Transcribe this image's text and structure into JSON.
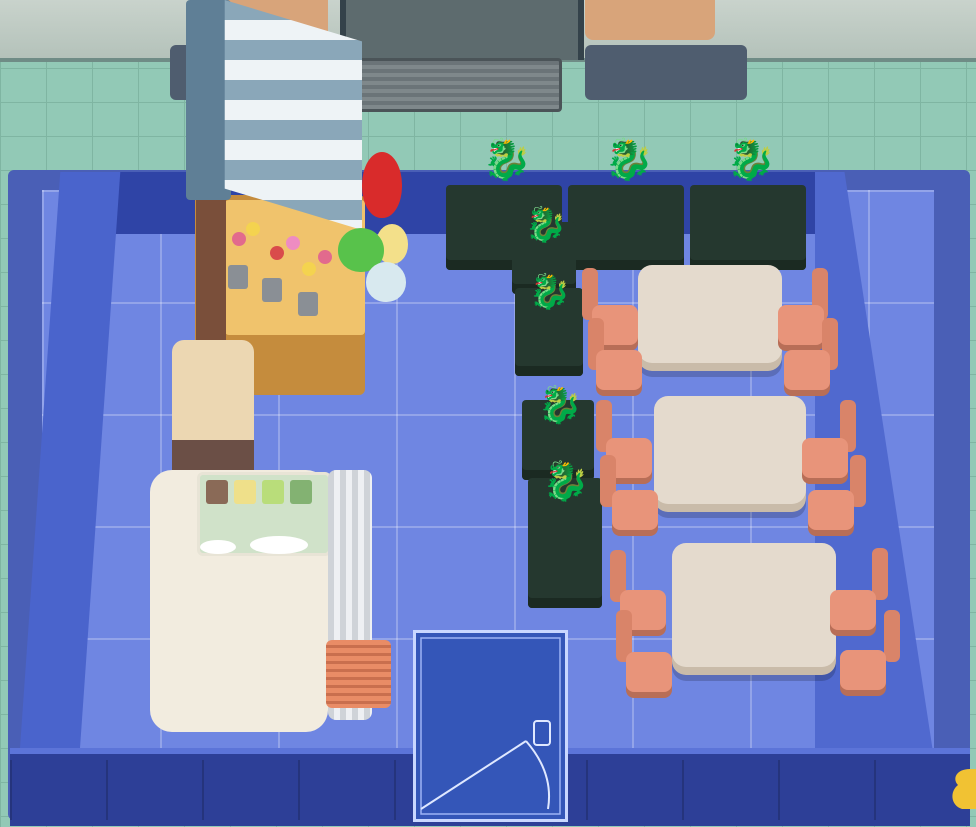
{
  "scene": "hospital-cafeteria-build-view",
  "room": {
    "floor_color": "#6f86e2",
    "wall_color": "#2d3f97",
    "door": "blueprint-door"
  },
  "objects": {
    "flower_stall": {
      "icon": "flower-stall-icon",
      "awning_colors": [
        "#8aa7b9",
        "#eef3f6"
      ],
      "balloons": [
        "#d92b2b",
        "#58c24b",
        "#f3e08a",
        "#d8e9ef"
      ]
    },
    "dragon_statues": {
      "icon": "dragon-statue-icon",
      "count": 7
    },
    "dining_tables": {
      "icon": "dining-table-icon",
      "count": 3,
      "chairs_per_table": 4,
      "chair_color": "#e8947a"
    },
    "drinks_counter": {
      "icon": "drinks-dispenser-icon",
      "swatches": [
        "#8a6a57",
        "#efe08a",
        "#b9dd7a",
        "#83b272",
        "#9b7a66"
      ]
    },
    "tray_stack": {
      "icon": "tray-stack-icon",
      "color": "#e98c66"
    }
  },
  "hud": {
    "corner_icon": "hud-corner-icon",
    "color": "#f1c233"
  }
}
